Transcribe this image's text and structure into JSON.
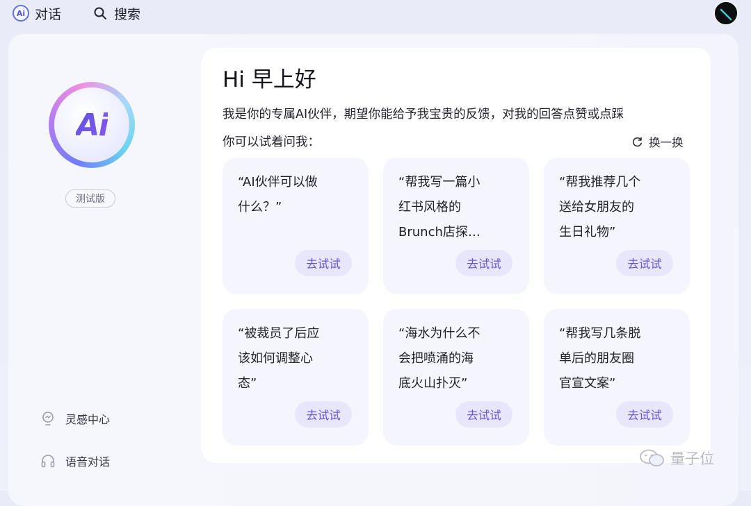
{
  "topbar": {
    "chat_tab": "对话",
    "chat_logo": "Ai",
    "search_tab": "搜索"
  },
  "sidebar": {
    "logo_text": "Ai",
    "beta_badge": "测试版",
    "links": [
      {
        "label": "灵感中心",
        "icon": "lightbulb-icon"
      },
      {
        "label": "语音对话",
        "icon": "headphones-icon"
      }
    ]
  },
  "main": {
    "greeting": "Hi 早上好",
    "intro": "我是你的专属AI伙伴，期望你能给予我宝贵的反馈，对我的回答点赞或点踩",
    "hint": "你可以试着问我：",
    "refresh_label": "换一换",
    "try_label": "去试试",
    "prompts": [
      [
        "“AI伙伴可以做",
        " 什么？”"
      ],
      [
        "“帮我写一篇小",
        " 红书风格的",
        " Brunch店探…"
      ],
      [
        "“帮我推荐几个",
        " 送给女朋友的",
        " 生日礼物”"
      ],
      [
        "“被裁员了后应",
        " 该如何调整心",
        " 态”"
      ],
      [
        "“海水为什么不",
        " 会把喷涌的海",
        " 底火山扑灭”"
      ],
      [
        "“帮我写几条脱",
        " 单后的朋友圈",
        " 官宣文案”"
      ]
    ]
  },
  "watermark": "量子位",
  "colors": {
    "accent": "#6a55e3",
    "try_button_bg": "#e8e6fb",
    "card_bg": "#f4f5fd",
    "page_bg": "#eceef9"
  }
}
